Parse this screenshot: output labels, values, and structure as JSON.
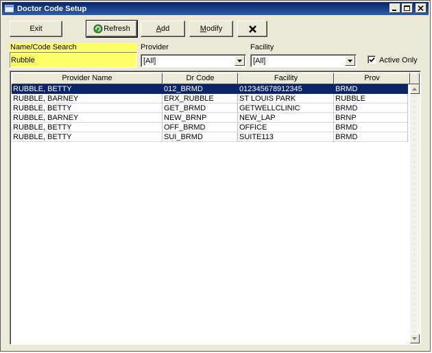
{
  "window": {
    "title": "Doctor Code Setup"
  },
  "toolbar": {
    "exit_label": "Exit",
    "refresh_label": "Refresh",
    "add_label": "Add",
    "modify_label": "Modify"
  },
  "search": {
    "label": "Name/Code Search",
    "value": "Rubble"
  },
  "provider": {
    "label": "Provider",
    "selected": "[All]"
  },
  "facility": {
    "label": "Facility",
    "selected": "[All]"
  },
  "active_only": {
    "label": "Active Only",
    "checked": true
  },
  "grid": {
    "columns": [
      "Provider Name",
      "Dr Code",
      "Facility",
      "Prov"
    ],
    "rows": [
      [
        "RUBBLE, BETTY",
        "012_BRMD",
        "012345678912345",
        "BRMD"
      ],
      [
        "RUBBLE, BARNEY",
        "ERX_RUBBLE",
        "ST LOUIS PARK",
        "RUBBLE"
      ],
      [
        "RUBBLE, BETTY",
        "GET_BRMD",
        "GETWELLCLINIC",
        "BRMD"
      ],
      [
        "RUBBLE, BARNEY",
        "NEW_BRNP",
        "NEW_LAP",
        "BRNP"
      ],
      [
        "RUBBLE, BETTY",
        "OFF_BRMD",
        "OFFICE",
        "BRMD"
      ],
      [
        "RUBBLE, BETTY",
        "SUI_BRMD",
        "SUITE113",
        "BRMD"
      ]
    ],
    "selected_row": 0
  },
  "colors": {
    "title_start": "#0a246a",
    "title_end": "#2d5ea8",
    "selection": "#0a246a",
    "search_highlight": "#ffff66"
  }
}
